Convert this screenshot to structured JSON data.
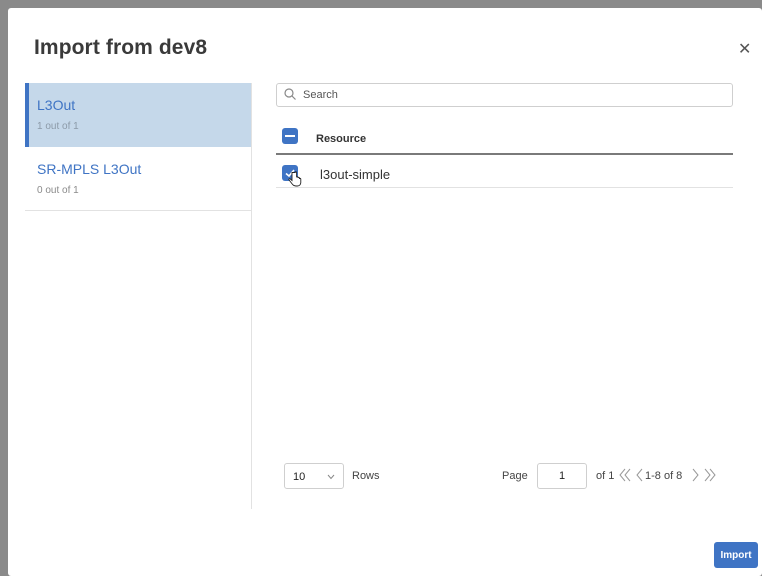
{
  "dialog": {
    "title": "Import from dev8",
    "close_icon": "close-icon"
  },
  "sidebar": {
    "items": [
      {
        "label": "L3Out",
        "sub": "1 out of 1",
        "active": true
      },
      {
        "label": "SR-MPLS L3Out",
        "sub": "0 out of 1",
        "active": false
      }
    ]
  },
  "search": {
    "placeholder": "Search",
    "value": ""
  },
  "table": {
    "header": "Resource",
    "rows": [
      {
        "label": "l3out-simple",
        "checked": true
      }
    ]
  },
  "pagination": {
    "rows_per_page": "10",
    "rows_label": "Rows",
    "page_label": "Page",
    "page_value": "1",
    "of_label": "of 1",
    "range": "1-8 of 8"
  },
  "footer": {
    "import_label": "Import"
  },
  "colors": {
    "accent": "#3f74c4",
    "active_bg": "#c5d8ea",
    "overlay": "#8a8a8a"
  }
}
